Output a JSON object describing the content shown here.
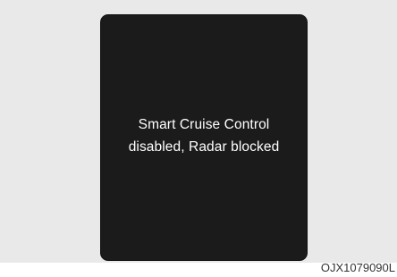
{
  "display": {
    "message_line1": "Smart Cruise Control",
    "message_line2": "disabled, Radar blocked"
  },
  "image_code": "OJX1079090L",
  "colors": {
    "panel_background": "#e9e9e9",
    "display_background": "#1b1b1b",
    "message_text": "#ffffff"
  }
}
